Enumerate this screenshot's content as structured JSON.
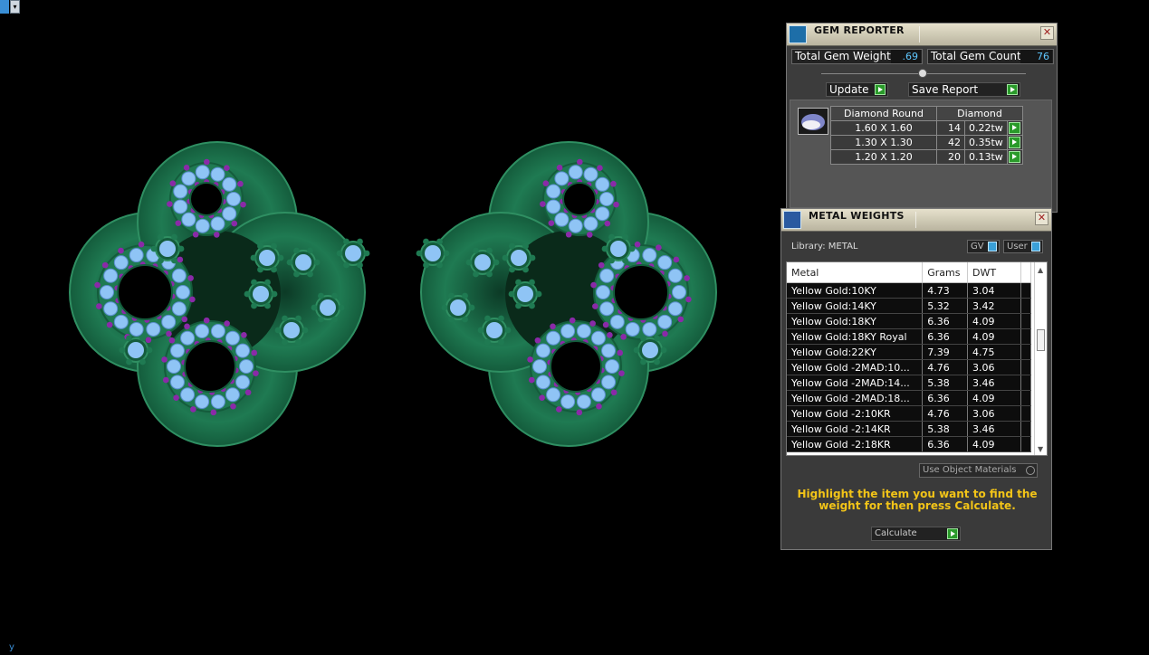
{
  "viewport": {
    "axis_label": "y"
  },
  "gem_reporter": {
    "title": "GEM REPORTER",
    "total_weight_label": "Total Gem Weight",
    "total_weight_value": ".69",
    "total_count_label": "Total Gem Count",
    "total_count_value": "76",
    "update_label": "Update",
    "save_report_label": "Save Report",
    "table": {
      "headers": [
        "Diamond Round",
        "Diamond"
      ],
      "rows": [
        {
          "size": "1.60 X 1.60",
          "count": "14",
          "weight": "0.22tw"
        },
        {
          "size": "1.30 X 1.30",
          "count": "42",
          "weight": "0.35tw"
        },
        {
          "size": "1.20 X 1.20",
          "count": "20",
          "weight": "0.13tw"
        }
      ]
    }
  },
  "metal_weights": {
    "title": "METAL WEIGHTS",
    "library_label": "Library: METAL",
    "gv_label": "GV",
    "user_label": "User",
    "columns": [
      "Metal",
      "Grams",
      "DWT"
    ],
    "rows": [
      {
        "metal": "Yellow Gold:10KY",
        "grams": "4.73",
        "dwt": "3.04"
      },
      {
        "metal": "Yellow Gold:14KY",
        "grams": "5.32",
        "dwt": "3.42"
      },
      {
        "metal": "Yellow Gold:18KY",
        "grams": "6.36",
        "dwt": "4.09"
      },
      {
        "metal": "Yellow Gold:18KY Royal",
        "grams": "6.36",
        "dwt": "4.09"
      },
      {
        "metal": "Yellow Gold:22KY",
        "grams": "7.39",
        "dwt": "4.75"
      },
      {
        "metal": "Yellow Gold -2MAD:10...",
        "grams": "4.76",
        "dwt": "3.06"
      },
      {
        "metal": "Yellow Gold -2MAD:14...",
        "grams": "5.38",
        "dwt": "3.46"
      },
      {
        "metal": "Yellow Gold -2MAD:18...",
        "grams": "6.36",
        "dwt": "4.09"
      },
      {
        "metal": "Yellow Gold -2:10KR",
        "grams": "4.76",
        "dwt": "3.06"
      },
      {
        "metal": "Yellow Gold -2:14KR",
        "grams": "5.38",
        "dwt": "3.46"
      },
      {
        "metal": "Yellow Gold -2:18KR",
        "grams": "6.36",
        "dwt": "4.09"
      }
    ],
    "use_object_materials_label": "Use Object Materials",
    "hint": "Highlight the item you want to find the weight for then press Calculate.",
    "calculate_label": "Calculate"
  },
  "colors": {
    "metal_green": "#1f7a52",
    "gem_blue": "#8fc4f5",
    "prong_purple": "#8a2aa8",
    "hint_yellow": "#f2c418",
    "value_blue": "#5fc7ff"
  }
}
